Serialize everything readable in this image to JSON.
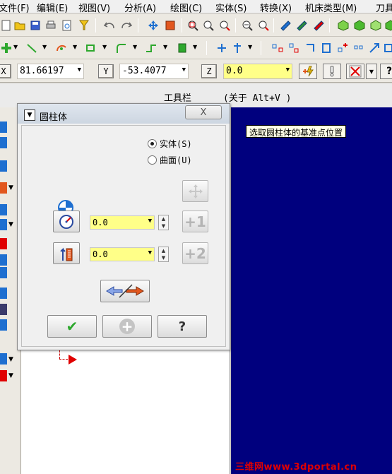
{
  "menu": [
    "文件(F)",
    "编辑(E)",
    "视图(V)",
    "分析(A)",
    "绘图(C)",
    "实体(S)",
    "转换(X)",
    "机床类型(M)",
    "刀具"
  ],
  "coords": {
    "x_label": "X",
    "x_value": "81.66197",
    "y_label": "Y",
    "y_value": "-53.4077",
    "z_label": "Z",
    "z_value": "0.0"
  },
  "label_strip": {
    "toolbar_label": "工具栏",
    "about_hint": "(关于 Alt+V )"
  },
  "prompt": "选取圆柱体的基准点位置",
  "watermark": "三维网www.3dportal.cn",
  "dialog": {
    "title": "圆柱体",
    "close_glyph": "X",
    "radio_solid": "实体(S)",
    "radio_surface": "曲面(U)",
    "radius_value": "0.0",
    "height_value": "0.0",
    "ok_glyph": "✔",
    "apply_glyph": "+",
    "help_glyph": "?",
    "plus_one": "+1",
    "plus_two": "+2"
  },
  "colors": {
    "graphics_bg": "#00007e",
    "field_highlight": "#ffff88",
    "watermark": "#e00000"
  },
  "icons": [
    "radius-icon",
    "height-icon",
    "reverse-direction-icon",
    "move-base-icon",
    "base-point-icon"
  ]
}
